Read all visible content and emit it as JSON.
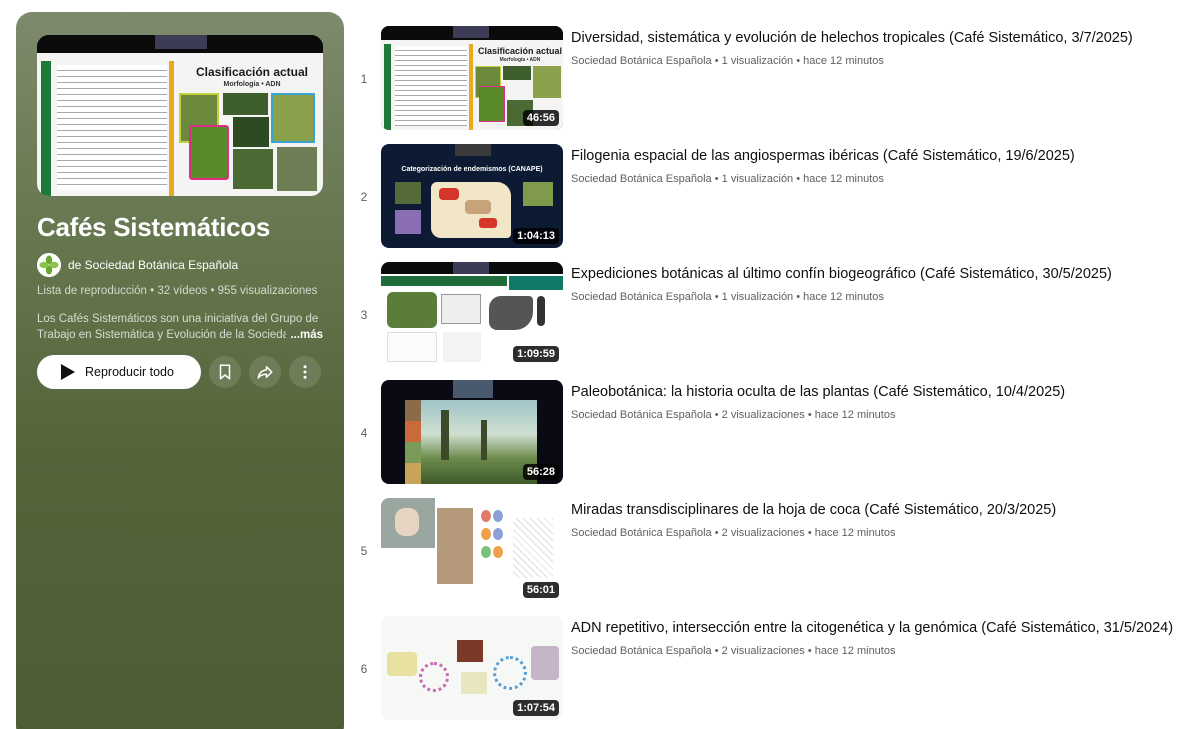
{
  "playlist": {
    "title": "Cafés Sistemáticos",
    "owner": "de Sociedad Botánica Española",
    "meta": "Lista de reproducción • 32 vídeos • 955 visualizaciones",
    "description": "Los Cafés Sistemáticos son una iniciativa del Grupo de Trabajo en Sistemática y Evolución de la Sociedad",
    "more_label": "...más",
    "play_all_label": "Reproducir todo",
    "thumb_title": "Clasificación actual",
    "thumb_subtitle": "Morfología • ADN",
    "icons": [
      "play-icon",
      "bookmark-icon",
      "share-icon",
      "more-vert-icon"
    ]
  },
  "videos": [
    {
      "index": "1",
      "title": "Diversidad, sistemática y evolución de helechos tropicales (Café Sistemático, 3/7/2025)",
      "channel": "Sociedad Botánica Española",
      "stats": "1 visualización • hace 12 minutos",
      "duration": "46:56",
      "thumb_text": "Clasificación actual",
      "thumb_sub": "Morfología • ADN"
    },
    {
      "index": "2",
      "title": "Filogenia espacial de las angiospermas ibéricas (Café Sistemático, 19/6/2025)",
      "channel": "Sociedad Botánica Española",
      "stats": "1 visualización • hace 12 minutos",
      "duration": "1:04:13",
      "thumb_text": "Categorización de endemismos (CANAPE)",
      "thumb_sub": ""
    },
    {
      "index": "3",
      "title": "Expediciones botánicas al último confín biogeográfico (Café Sistemático, 30/5/2025)",
      "channel": "Sociedad Botánica Española",
      "stats": "1 visualización • hace 12 minutos",
      "duration": "1:09:59",
      "thumb_text": "",
      "thumb_sub": ""
    },
    {
      "index": "4",
      "title": "Paleobotánica: la historia oculta de las plantas (Café Sistemático, 10/4/2025)",
      "channel": "Sociedad Botánica Española",
      "stats": "2 visualizaciones • hace 12 minutos",
      "duration": "56:28",
      "thumb_text": "",
      "thumb_sub": ""
    },
    {
      "index": "5",
      "title": "Miradas transdisciplinares de la hoja de coca (Café Sistemático, 20/3/2025)",
      "channel": "Sociedad Botánica Española",
      "stats": "2 visualizaciones • hace 12 minutos",
      "duration": "56:01",
      "thumb_text": "",
      "thumb_sub": ""
    },
    {
      "index": "6",
      "title": "ADN repetitivo, intersección entre la citogenética y la genómica (Café Sistemático, 31/5/2024)",
      "channel": "Sociedad Botánica Española",
      "stats": "2 visualizaciones • hace 12 minutos",
      "duration": "1:07:54",
      "thumb_text": "",
      "thumb_sub": ""
    }
  ],
  "colors": {
    "panel_top": "#7d8a6c",
    "panel_bottom": "#4d5c34",
    "meta_gray": "#606060"
  }
}
